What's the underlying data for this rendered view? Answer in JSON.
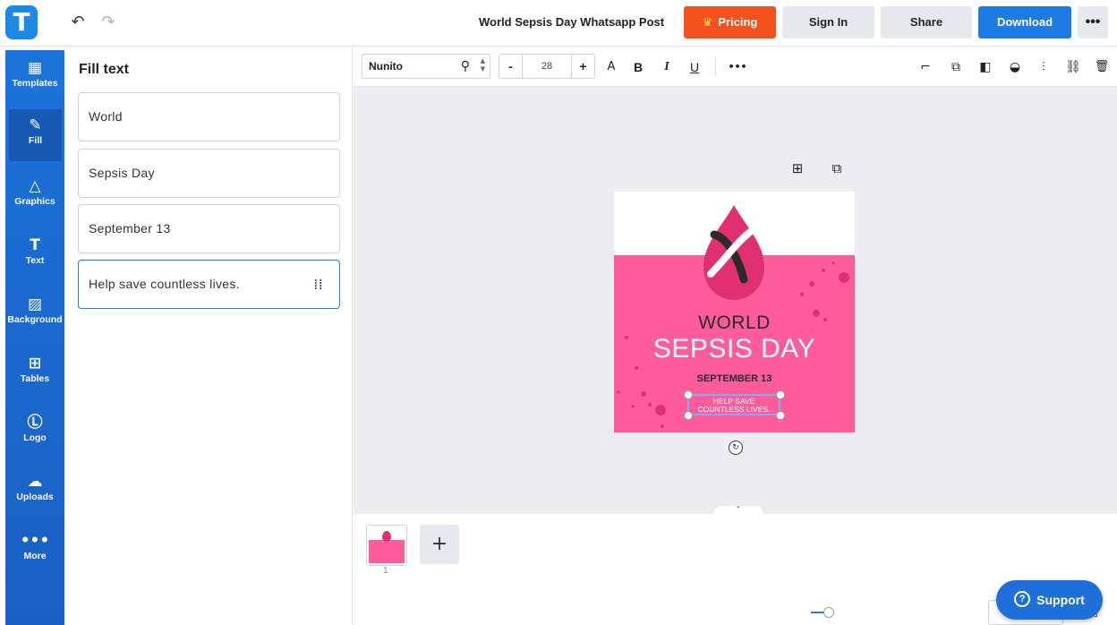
{
  "app": {
    "logo_letter": "T",
    "doc_title": "World Sepsis Day Whatsapp Post"
  },
  "header": {
    "undo_icon": "↶",
    "redo_icon": "↷",
    "pricing_icon": "♛",
    "pricing_label": "Pricing",
    "signin_label": "Sign In",
    "share_label": "Share",
    "download_label": "Download",
    "more_label": "•••"
  },
  "sidebar": {
    "items": [
      {
        "label": "Templates",
        "icon": "▦"
      },
      {
        "label": "Fill",
        "icon": "✎"
      },
      {
        "label": "Graphics",
        "icon": "△"
      },
      {
        "label": "Text",
        "icon": "T"
      },
      {
        "label": "Background",
        "icon": "▨"
      },
      {
        "label": "Tables",
        "icon": "⊞"
      },
      {
        "label": "Logo",
        "icon": "Ⓛ"
      },
      {
        "label": "Uploads",
        "icon": "☁"
      },
      {
        "label": "More",
        "icon": "•••"
      }
    ]
  },
  "panel": {
    "title": "Fill text",
    "fields": [
      {
        "value": "World"
      },
      {
        "value": "Sepsis Day"
      },
      {
        "value": "September 13"
      },
      {
        "value": "Help save countless lives."
      }
    ],
    "drag_icon": "⁞⁞",
    "collapse_icon": "‹"
  },
  "toolbar": {
    "font_family": "Nunito",
    "search_icon": "⚲",
    "spin_up": "▲",
    "spin_down": "▼",
    "size_minus": "-",
    "font_size": "28",
    "size_plus": "+",
    "case_label": "A",
    "bold_label": "B",
    "italic_label": "I",
    "underline_label": "U",
    "more_label": "•••",
    "right_icons": {
      "paint_roller": "⌐",
      "copy": "⧉",
      "layer": "◧",
      "opacity": "◒",
      "align": "⫶",
      "link": "⛓",
      "delete": "🗑"
    }
  },
  "canvas": {
    "add_icon": "⊞",
    "duplicate_icon": "⧉",
    "rotate_icon": "↻",
    "expand_icon": "ˇ",
    "design": {
      "world": "WORLD",
      "sepsis_day": "SEPSIS DAY",
      "date": "SEPTEMBER 13",
      "help_line1": "HELP SAVE",
      "help_line2": "COUNTLESS LIVES.",
      "pink_color": "#ff5c9b",
      "drop_color": "#e0306f"
    }
  },
  "pages": {
    "thumb_number": "1",
    "add_label": "+"
  },
  "bottom": {
    "support_icon": "?",
    "support_label": "Support",
    "fit_icon": "⛶"
  }
}
